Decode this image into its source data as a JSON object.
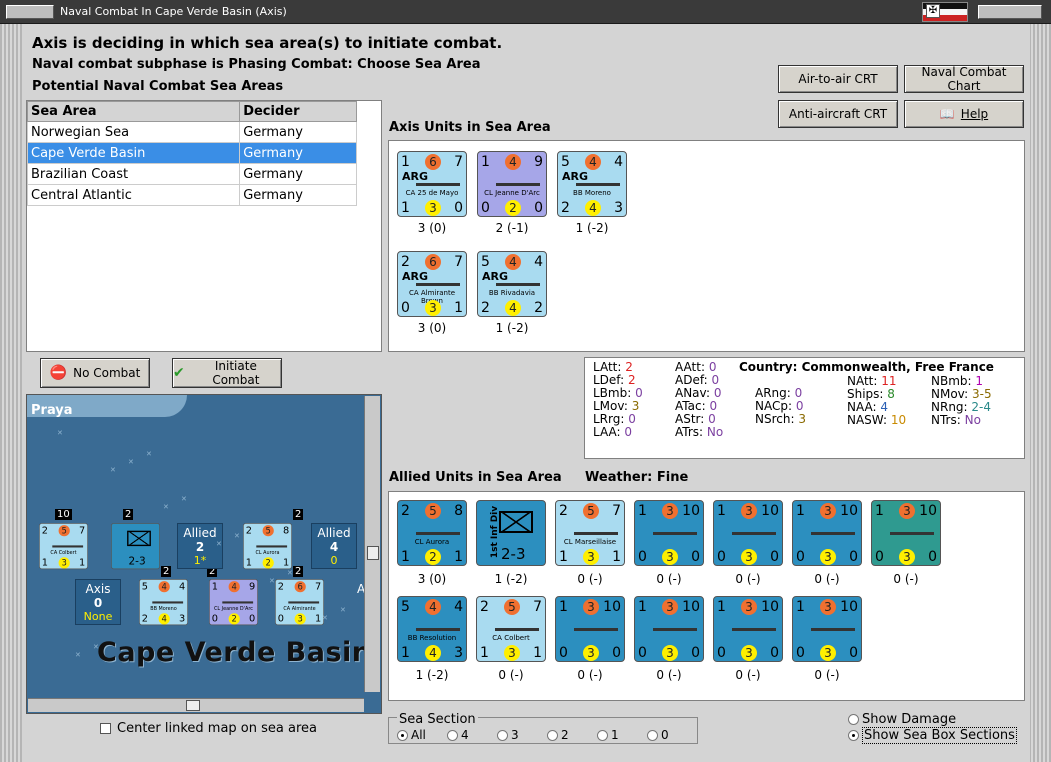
{
  "window": {
    "title": "Naval Combat In Cape Verde Basin (Axis)"
  },
  "header": {
    "line1": "Axis is deciding in which sea area(s) to initiate combat.",
    "line2": "Naval combat subphase is Phasing Combat: Choose Sea Area",
    "line3": "Potential Naval Combat Sea Areas"
  },
  "sea_table": {
    "headers": [
      "Sea Area",
      "Decider"
    ],
    "rows": [
      {
        "area": "Norwegian Sea",
        "decider": "Germany"
      },
      {
        "area": "Cape Verde Basin",
        "decider": "Germany",
        "selected": true
      },
      {
        "area": "Brazilian Coast",
        "decider": "Germany"
      },
      {
        "area": "Central Atlantic",
        "decider": "Germany"
      }
    ]
  },
  "buttons": {
    "air_crt": "Air-to-air CRT",
    "naval_chart": "Naval Combat Chart",
    "aa_crt": "Anti-aircraft CRT",
    "help": "Help",
    "no_combat": "No Combat",
    "initiate": "Initiate Combat"
  },
  "axis_units": {
    "title": "Axis Units in Sea Area",
    "units": [
      {
        "tl": "1",
        "att": "6",
        "tr": "7",
        "nat": "ARG",
        "name": "CA 25 de Mayo",
        "bl": "1",
        "def": "3",
        "br": "0",
        "cap": "3 (0)",
        "color": "lb"
      },
      {
        "tl": "1",
        "att": "4",
        "tr": "9",
        "nat": "",
        "name": "CL Jeanne D'Arc",
        "bl": "0",
        "def": "2",
        "br": "0",
        "cap": "2 (-1)",
        "color": "pb"
      },
      {
        "tl": "5",
        "att": "4",
        "tr": "4",
        "nat": "ARG",
        "name": "BB Moreno",
        "bl": "2",
        "def": "4",
        "br": "3",
        "cap": "1 (-2)",
        "color": "lb"
      },
      {
        "tl": "2",
        "att": "6",
        "tr": "7",
        "nat": "ARG",
        "name": "CA Almirante Brown",
        "bl": "0",
        "def": "3",
        "br": "1",
        "cap": "3 (0)",
        "color": "lb"
      },
      {
        "tl": "5",
        "att": "4",
        "tr": "4",
        "nat": "ARG",
        "name": "BB Rivadavia",
        "bl": "2",
        "def": "4",
        "br": "2",
        "cap": "1 (-2)",
        "color": "lb"
      }
    ]
  },
  "stats": {
    "country_label": "Country:",
    "country": "Commonwealth, Free France",
    "col1": [
      [
        "LAtt:",
        "2"
      ],
      [
        "LDef:",
        "2"
      ],
      [
        "LBmb:",
        "0"
      ],
      [
        "LMov:",
        "3"
      ],
      [
        "LRrg:",
        "0"
      ],
      [
        "LAA:",
        "0"
      ]
    ],
    "col2": [
      [
        "AAtt:",
        "0"
      ],
      [
        "ADef:",
        "0"
      ],
      [
        "ANav:",
        "0"
      ],
      [
        "ATac:",
        "0"
      ],
      [
        "AStr:",
        "0"
      ],
      [
        "ATrs:",
        "No"
      ]
    ],
    "col3": [
      [
        "ARng:",
        "0"
      ],
      [
        "NACp:",
        "0"
      ],
      [
        "NSrch:",
        "3"
      ]
    ],
    "col4": [
      [
        "NAtt:",
        "11"
      ],
      [
        "Ships:",
        "8"
      ],
      [
        "NAA:",
        "4"
      ],
      [
        "NASW:",
        "10"
      ]
    ],
    "col5": [
      [
        "NBmb:",
        "1"
      ],
      [
        "NMov:",
        "3-5"
      ],
      [
        "NRng:",
        "2-4"
      ],
      [
        "NTrs:",
        "No"
      ]
    ]
  },
  "allied_units": {
    "title": "Allied Units in Sea Area",
    "weather_label": "Weather:",
    "weather": "Fine",
    "row1": [
      {
        "tl": "2",
        "att": "5",
        "tr": "8",
        "name": "CL Aurora",
        "bl": "1",
        "def": "2",
        "br": "1",
        "cap": "3 (0)",
        "color": "db"
      },
      {
        "tl": "",
        "att": "",
        "tr": "",
        "name": "1st Inf Div",
        "bl": "",
        "def": "",
        "br": "",
        "cap": "1 (-2)",
        "color": "db",
        "inf": "2-3"
      },
      {
        "tl": "2",
        "att": "5",
        "tr": "7",
        "name": "CL Marseillaise",
        "bl": "1",
        "def": "3",
        "br": "1",
        "cap": "0 (-)",
        "color": "lb"
      },
      {
        "tl": "1",
        "att": "3",
        "tr": "10",
        "name": "",
        "bl": "0",
        "def": "3",
        "br": "0",
        "cap": "0 (-)",
        "color": "db"
      },
      {
        "tl": "1",
        "att": "3",
        "tr": "10",
        "name": "",
        "bl": "0",
        "def": "3",
        "br": "0",
        "cap": "0 (-)",
        "color": "db"
      },
      {
        "tl": "1",
        "att": "3",
        "tr": "10",
        "name": "",
        "bl": "0",
        "def": "3",
        "br": "0",
        "cap": "0 (-)",
        "color": "db"
      },
      {
        "tl": "1",
        "att": "3",
        "tr": "10",
        "name": "",
        "bl": "0",
        "def": "3",
        "br": "0",
        "cap": "0 (-)",
        "color": "tl"
      }
    ],
    "row2": [
      {
        "tl": "5",
        "att": "4",
        "tr": "4",
        "name": "BB Resolution",
        "bl": "1",
        "def": "4",
        "br": "3",
        "cap": "1 (-2)",
        "color": "db"
      },
      {
        "tl": "2",
        "att": "5",
        "tr": "7",
        "name": "CA Colbert",
        "bl": "1",
        "def": "3",
        "br": "1",
        "cap": "0 (-)",
        "color": "lb"
      },
      {
        "tl": "1",
        "att": "3",
        "tr": "10",
        "name": "",
        "bl": "0",
        "def": "3",
        "br": "0",
        "cap": "0 (-)",
        "color": "db"
      },
      {
        "tl": "1",
        "att": "3",
        "tr": "10",
        "name": "",
        "bl": "0",
        "def": "3",
        "br": "0",
        "cap": "0 (-)",
        "color": "db"
      },
      {
        "tl": "1",
        "att": "3",
        "tr": "10",
        "name": "",
        "bl": "0",
        "def": "3",
        "br": "0",
        "cap": "0 (-)",
        "color": "db"
      },
      {
        "tl": "1",
        "att": "3",
        "tr": "10",
        "name": "",
        "bl": "0",
        "def": "3",
        "br": "0",
        "cap": "0 (-)",
        "color": "db"
      }
    ]
  },
  "map": {
    "city": "Praya",
    "sea_name": "Cape Verde Basin",
    "allied_box1": {
      "label": "Allied",
      "val": "2",
      "sub": "1*"
    },
    "allied_box2": {
      "label": "Allied",
      "val": "4",
      "sub": "0"
    },
    "axis_box": {
      "label": "Axis",
      "val": "0",
      "sub": "None"
    },
    "extra_label": "A:",
    "stack_nums": [
      "10",
      "2",
      "2",
      "2",
      "2",
      "2"
    ],
    "counters": [
      {
        "tl": "2",
        "att": "5",
        "tr": "7",
        "name": "CA Colbert",
        "bl": "1",
        "def": "3",
        "br": "1"
      },
      {
        "tl": "2",
        "att": "5",
        "tr": "8",
        "name": "CL Aurora",
        "bl": "1",
        "def": "2",
        "br": "1"
      },
      {
        "tl": "5",
        "att": "4",
        "tr": "4",
        "name": "BB Moreno",
        "bl": "2",
        "def": "4",
        "br": "3"
      },
      {
        "tl": "1",
        "att": "4",
        "tr": "9",
        "name": "CL Jeanne D'Arc",
        "bl": "0",
        "def": "2",
        "br": "0"
      },
      {
        "tl": "2",
        "att": "6",
        "tr": "7",
        "name": "CA Almirante",
        "bl": "0",
        "def": "3",
        "br": "1"
      }
    ],
    "inf": "2-3"
  },
  "footer": {
    "center_map": "Center linked map on sea area",
    "sea_section": "Sea Section",
    "sections": [
      "All",
      "4",
      "3",
      "2",
      "1",
      "0"
    ],
    "show_damage": "Show Damage",
    "show_sections": "Show Sea Box Sections"
  }
}
